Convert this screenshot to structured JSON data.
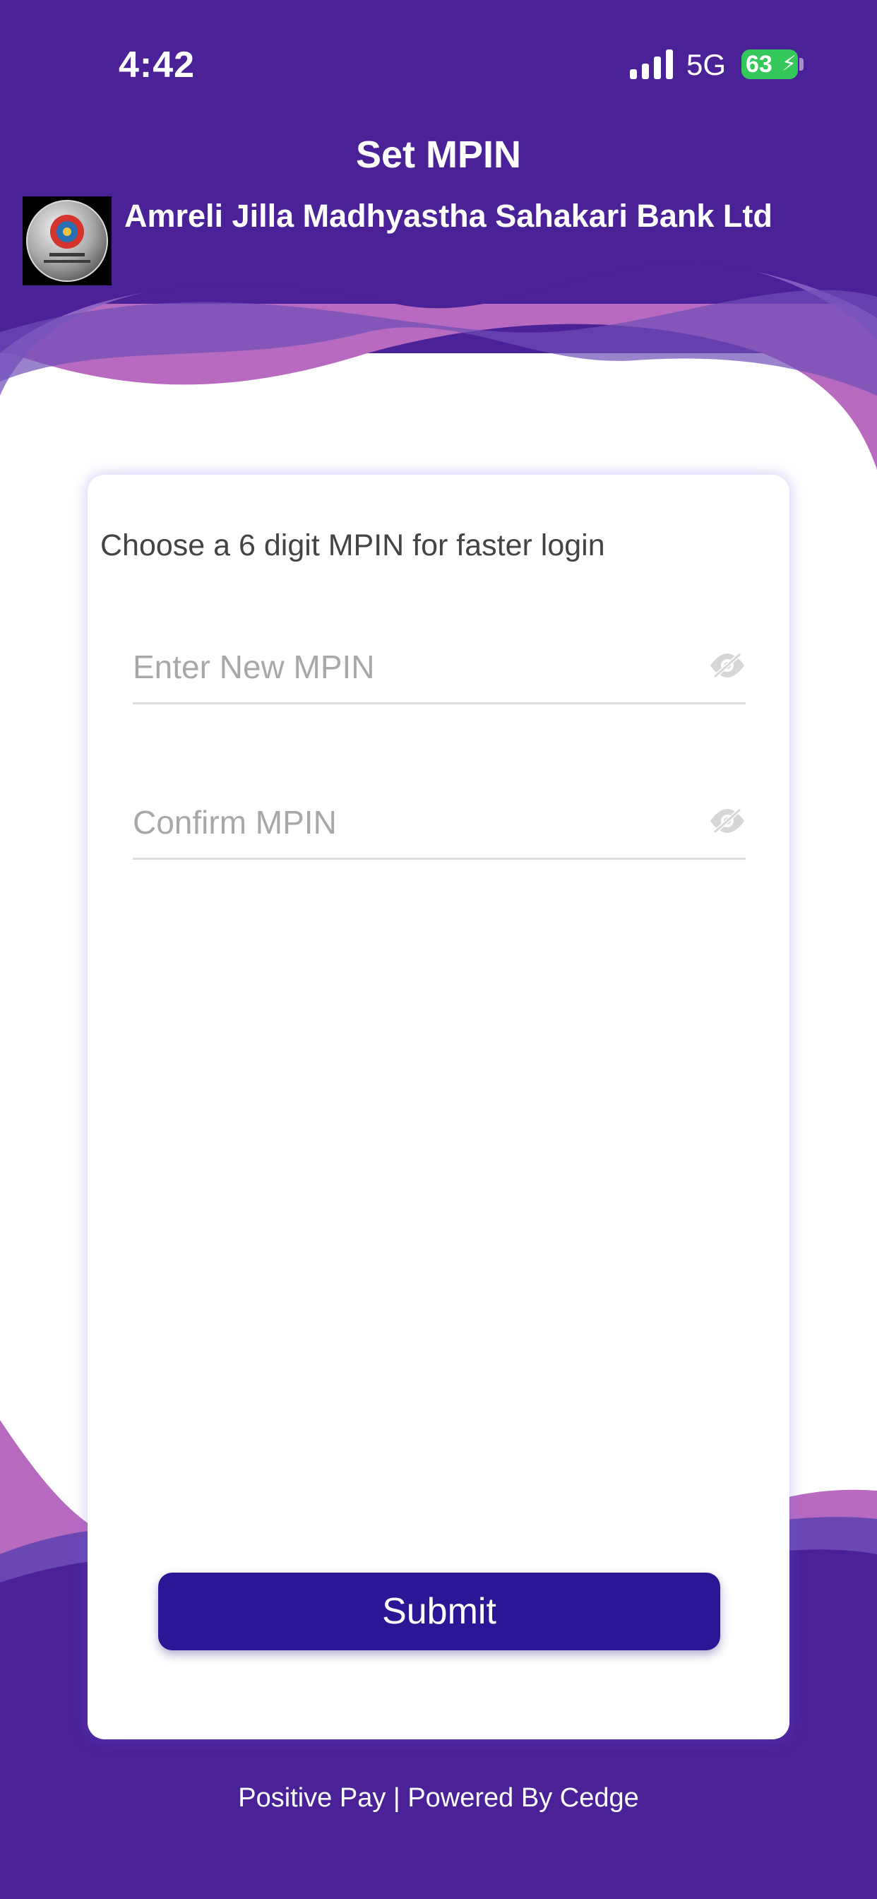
{
  "status_bar": {
    "time": "4:42",
    "network": "5G",
    "battery": "63"
  },
  "header": {
    "title": "Set MPIN",
    "bank_name": "Amreli Jilla Madhyastha Sahakari Bank Ltd"
  },
  "form": {
    "instruction": "Choose a 6 digit MPIN for faster login",
    "new_mpin": {
      "placeholder": "Enter New MPIN",
      "value": ""
    },
    "confirm_mpin": {
      "placeholder": "Confirm MPIN",
      "value": ""
    },
    "submit_label": "Submit"
  },
  "footer": {
    "text": "Positive Pay | Powered By Cedge"
  },
  "colors": {
    "header_purple": "#4a2197",
    "wave_pink": "#b86ac0",
    "button": "#2b1795",
    "battery_green": "#34c759"
  },
  "icons": [
    "signal-icon",
    "battery-icon",
    "bank-logo",
    "eye-slash-icon"
  ]
}
